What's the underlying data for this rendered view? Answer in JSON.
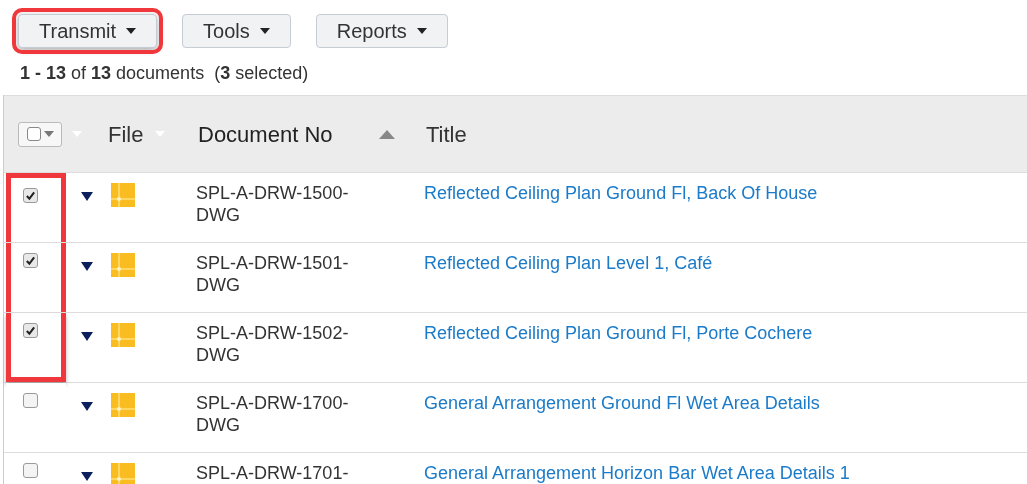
{
  "toolbar": [
    {
      "label": "Transmit",
      "highlighted": true
    },
    {
      "label": "Tools",
      "highlighted": false
    },
    {
      "label": "Reports",
      "highlighted": false
    }
  ],
  "summary": "**1 - 13** of **13** documents  (**3** selected)",
  "table": {
    "select_all": {
      "checked": false
    },
    "columns": [
      {
        "label": "File",
        "sorted": false
      },
      {
        "label": "Document No",
        "sorted": true
      },
      {
        "label": "Title",
        "sorted": false
      }
    ],
    "rows": [
      {
        "checked": true,
        "highlighted": true,
        "doc_no": [
          "SPL-A-DRW-1500-",
          "DWG"
        ],
        "title": "Reflected Ceiling Plan Ground Fl, Back Of House"
      },
      {
        "checked": true,
        "highlighted": true,
        "doc_no": [
          "SPL-A-DRW-1501-",
          "DWG"
        ],
        "title": "Reflected Ceiling Plan Level 1, Café"
      },
      {
        "checked": true,
        "highlighted": true,
        "doc_no": [
          "SPL-A-DRW-1502-",
          "DWG"
        ],
        "title": "Reflected Ceiling Plan Ground Fl, Porte Cochere"
      },
      {
        "checked": false,
        "highlighted": false,
        "doc_no": [
          "SPL-A-DRW-1700-",
          "DWG"
        ],
        "title": "General Arrangement Ground Fl Wet Area Details"
      },
      {
        "checked": false,
        "highlighted": false,
        "doc_no": [
          "SPL-A-DRW-1701-"
        ],
        "title": "General Arrangement Horizon Bar Wet Area Details 1"
      }
    ]
  }
}
